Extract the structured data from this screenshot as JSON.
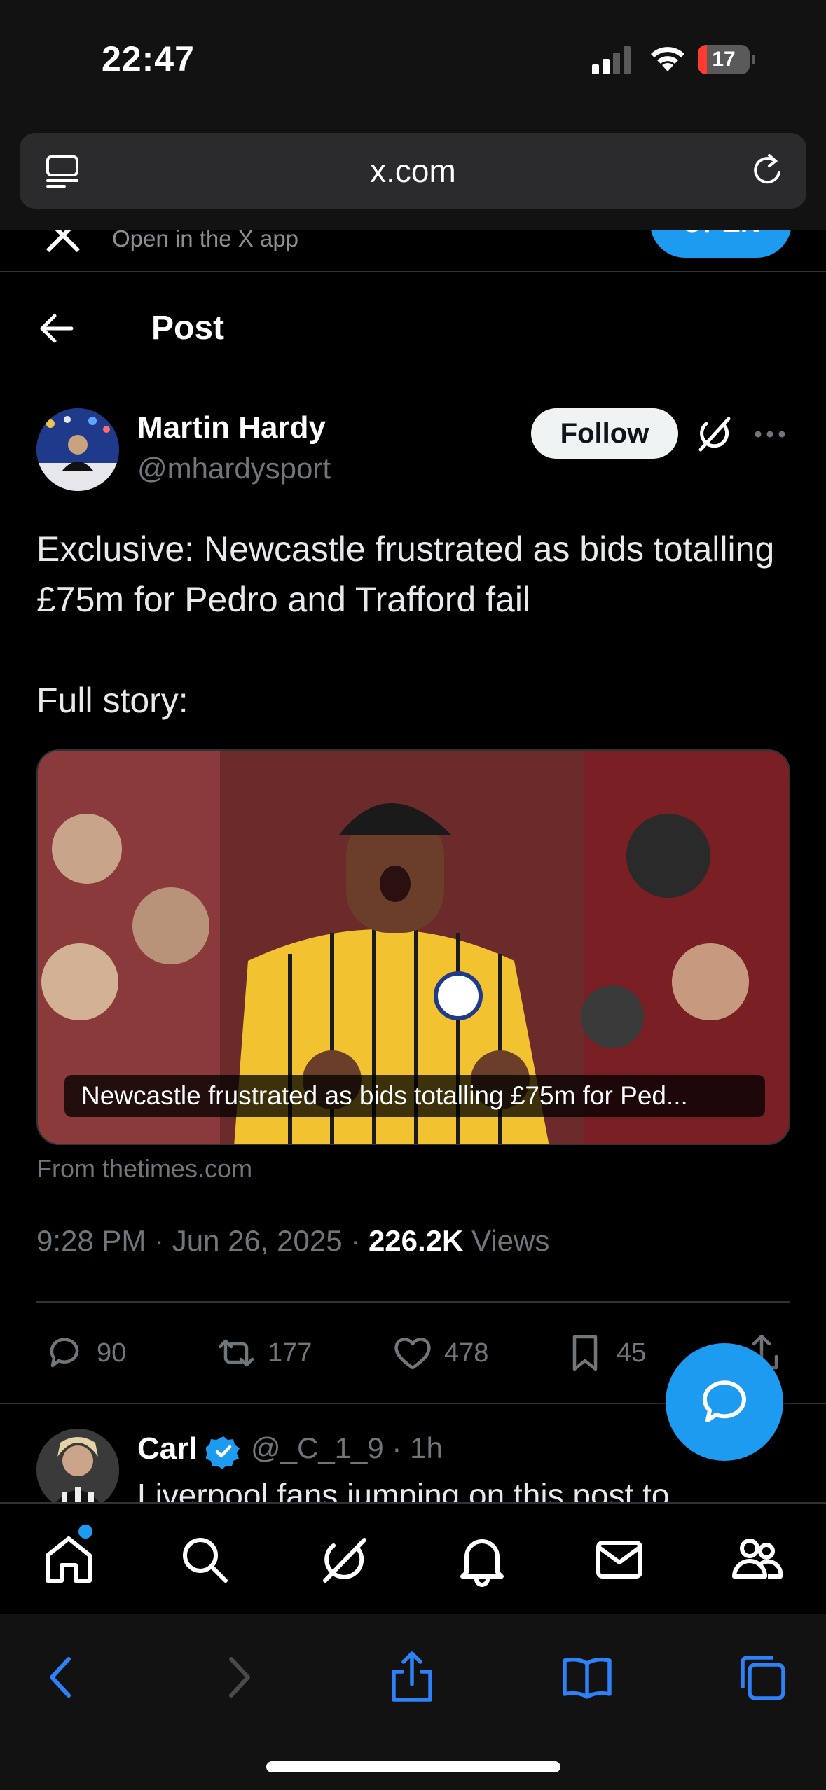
{
  "status_bar": {
    "time": "22:47",
    "battery_level": "17",
    "battery_fraction": 0.17,
    "signal_bars_filled": 2
  },
  "browser": {
    "url": "x.com",
    "icons": [
      "tabs-overview-icon",
      "reload-icon"
    ]
  },
  "app_banner": {
    "text": "Open in the X app",
    "button": "OPEN"
  },
  "header": {
    "title": "Post"
  },
  "post": {
    "author_name": "Martin Hardy",
    "author_handle": "@mhardysport",
    "follow_label": "Follow",
    "text": "Exclusive: Newcastle frustrated as bids totalling £75m for Pedro and Trafford fail\n\nFull story:",
    "card_caption": "Newcastle frustrated as bids totalling £75m for Ped...",
    "card_source": "From thetimes.com",
    "timestamp": "9:28 PM · Jun 26, 2025 · ",
    "views_count": "226.2K",
    "views_label": " Views",
    "replies": "90",
    "reposts": "177",
    "likes": "478",
    "bookmarks": "45"
  },
  "reply": {
    "name": "Carl",
    "meta": "@_C_1_9 · 1h",
    "text": "Liverpool fans jumping on this post to"
  },
  "colors": {
    "accent": "#1d9bf0",
    "muted": "#71767b",
    "battery_low": "#ff3b30"
  }
}
